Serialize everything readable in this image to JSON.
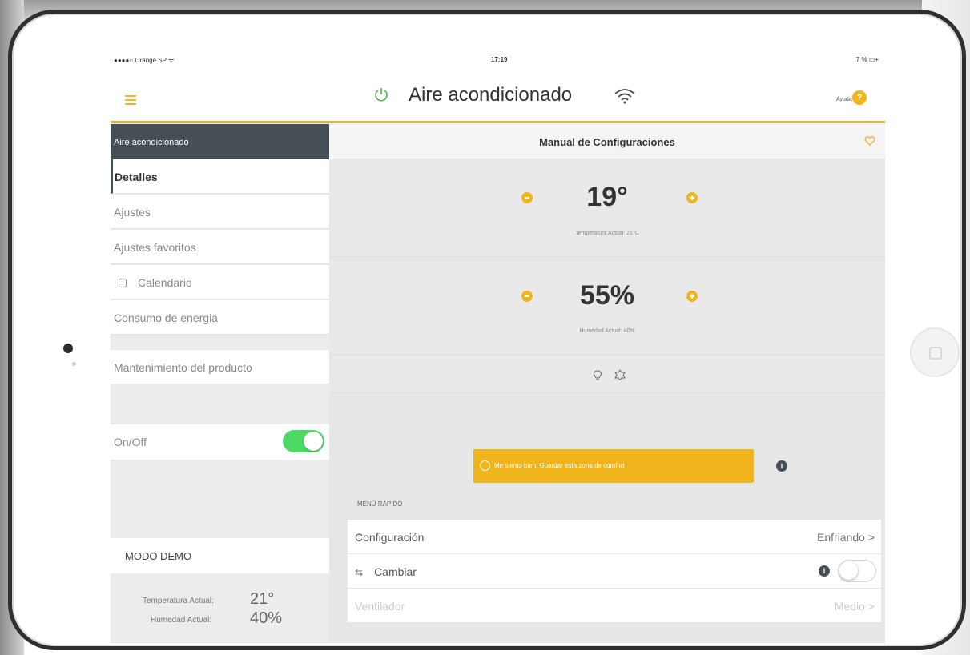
{
  "status_bar": {
    "carrier": "●●●●○ Orange SP ᯤ",
    "time": "17:19",
    "battery": "7 % ▭+"
  },
  "nav": {
    "title": "Aire acondicionado",
    "help_label": "Ayuda",
    "help_badge": "?"
  },
  "sidebar": {
    "header": "Aire acondicionado",
    "items": [
      {
        "label": "Detalles"
      },
      {
        "label": "Ajustes"
      },
      {
        "label": "Ajustes favoritos"
      },
      {
        "label": "Calendario"
      },
      {
        "label": "Consumo de energia"
      },
      {
        "label": "Mantenimiento del producto"
      }
    ],
    "onoff_label": "On/Off",
    "onoff_state": true,
    "demo_label": "MODO DEMO",
    "demo_temp_label": "Temperatura Actual:",
    "demo_temp_value": "21°",
    "demo_hum_label": "Humedad Actual:",
    "demo_hum_value": "40%"
  },
  "main": {
    "title": "Manual de Configuraciones",
    "temperature": {
      "value": "19°",
      "label": "Temperatura Actual: 21°C"
    },
    "humidity": {
      "value": "55%",
      "label": "Humedad Actual: 40%"
    },
    "comfort_button": "Me siento bien: Guardar esta zona de comfort",
    "info_badge": "i",
    "quick_menu_label": "MENÚ RÁPIDO",
    "quick_rows": [
      {
        "label": "Configuración",
        "value": "Enfriando >"
      },
      {
        "label": "Cambiar",
        "value": "",
        "toggle": false
      },
      {
        "label": "Ventilador",
        "value": "Medio >"
      }
    ]
  },
  "colors": {
    "accent": "#f0b51d",
    "dark": "#464f56",
    "toggle_on": "#4cd964"
  }
}
